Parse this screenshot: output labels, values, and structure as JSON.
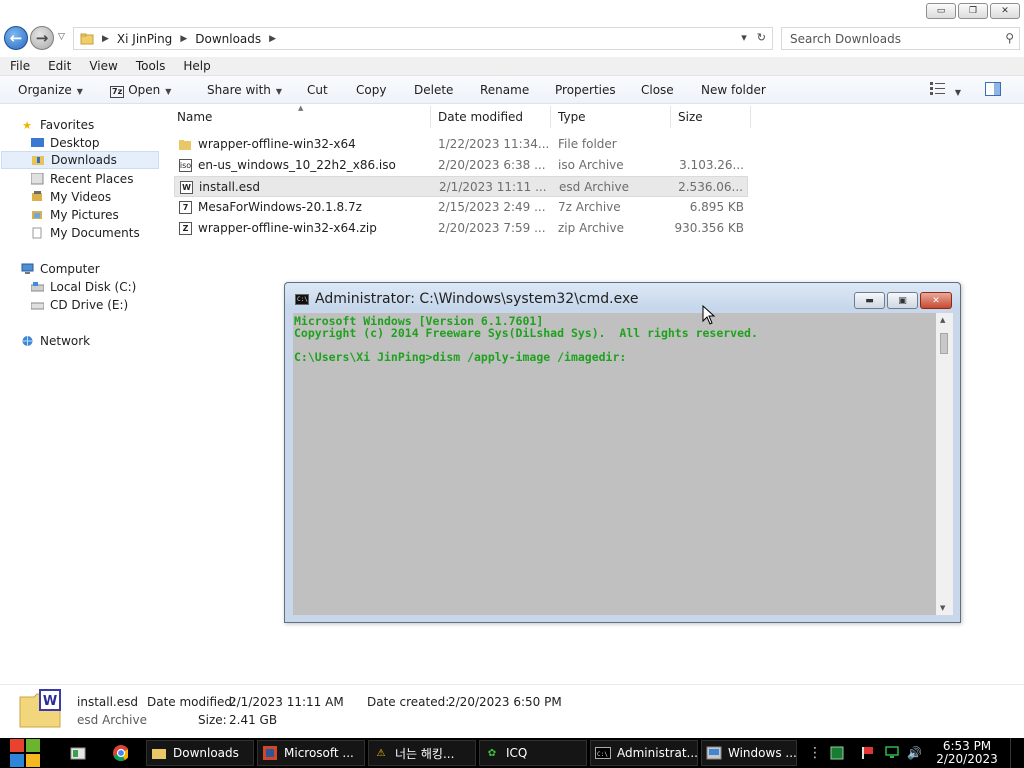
{
  "window": {
    "minimize": "▭",
    "restore": "❐",
    "close": "✕"
  },
  "address": {
    "crumbs": [
      "Xi JinPing",
      "Downloads"
    ],
    "search_placeholder": "Search Downloads"
  },
  "menu": [
    "File",
    "Edit",
    "View",
    "Tools",
    "Help"
  ],
  "commands": {
    "organize": "Organize",
    "open": "Open",
    "share_with": "Share with",
    "cut": "Cut",
    "copy": "Copy",
    "delete": "Delete",
    "rename": "Rename",
    "properties": "Properties",
    "close": "Close",
    "new_folder": "New folder"
  },
  "nav": {
    "favorites": "Favorites",
    "desktop": "Desktop",
    "downloads": "Downloads",
    "recent_places": "Recent Places",
    "my_videos": "My Videos",
    "my_pictures": "My Pictures",
    "my_documents": "My Documents",
    "computer": "Computer",
    "local_disk": "Local Disk (C:)",
    "cd_drive": "CD Drive (E:)",
    "network": "Network"
  },
  "columns": {
    "name": "Name",
    "date_modified": "Date modified",
    "type": "Type",
    "size": "Size"
  },
  "files": [
    {
      "name": "wrapper-offline-win32-x64",
      "date": "1/22/2023 11:34...",
      "type": "File folder",
      "size": "",
      "icon": "folder-icon"
    },
    {
      "name": "en-us_windows_10_22h2_x86.iso",
      "date": "2/20/2023 6:38 ...",
      "type": "iso Archive",
      "size": "3.103.26...",
      "icon": "iso-file-icon"
    },
    {
      "name": "install.esd",
      "date": "2/1/2023 11:11 ...",
      "type": "esd Archive",
      "size": "2.536.06...",
      "icon": "esd-file-icon"
    },
    {
      "name": "MesaForWindows-20.1.8.7z",
      "date": "2/15/2023 2:49 ...",
      "type": "7z Archive",
      "size": "6.895 KB",
      "icon": "7z-file-icon"
    },
    {
      "name": "wrapper-offline-win32-x64.zip",
      "date": "2/20/2023 7:59 ...",
      "type": "zip Archive",
      "size": "930.356 KB",
      "icon": "zip-file-icon"
    }
  ],
  "details": {
    "name": "install.esd",
    "type": "esd Archive",
    "date_modified_label": "Date modified:",
    "date_modified": "2/1/2023 11:11 AM",
    "date_created_label": "Date created:",
    "date_created": "2/20/2023 6:50 PM",
    "size_label": "Size:",
    "size": "2.41 GB"
  },
  "cmd": {
    "title": "Administrator: C:\\Windows\\system32\\cmd.exe",
    "lines": [
      "Microsoft Windows [Version 6.1.7601]",
      "Copyright (c) 2014 Freeware Sys(DiLshad Sys).  All rights reserved.",
      "",
      "C:\\Users\\Xi JinPing>dism /apply-image /imagedir:"
    ],
    "text_color": "#1ea21e",
    "bg_color": "#c0c0c0"
  },
  "taskbar": {
    "items": [
      {
        "label": "",
        "icon": "explorer-icon"
      },
      {
        "label": "",
        "icon": "chrome-icon"
      },
      {
        "label": "Downloads",
        "icon": "folder-icon"
      },
      {
        "label": "Microsoft ...",
        "icon": "office-icon"
      },
      {
        "label": "너는 해킹...",
        "icon": "warning-icon"
      },
      {
        "label": "ICQ",
        "icon": "icq-icon"
      },
      {
        "label": "Administrat...",
        "icon": "cmd-icon"
      },
      {
        "label": "Windows ...",
        "icon": "windows-app-icon"
      }
    ],
    "clock_time": "6:53 PM",
    "clock_date": "2/20/2023"
  }
}
